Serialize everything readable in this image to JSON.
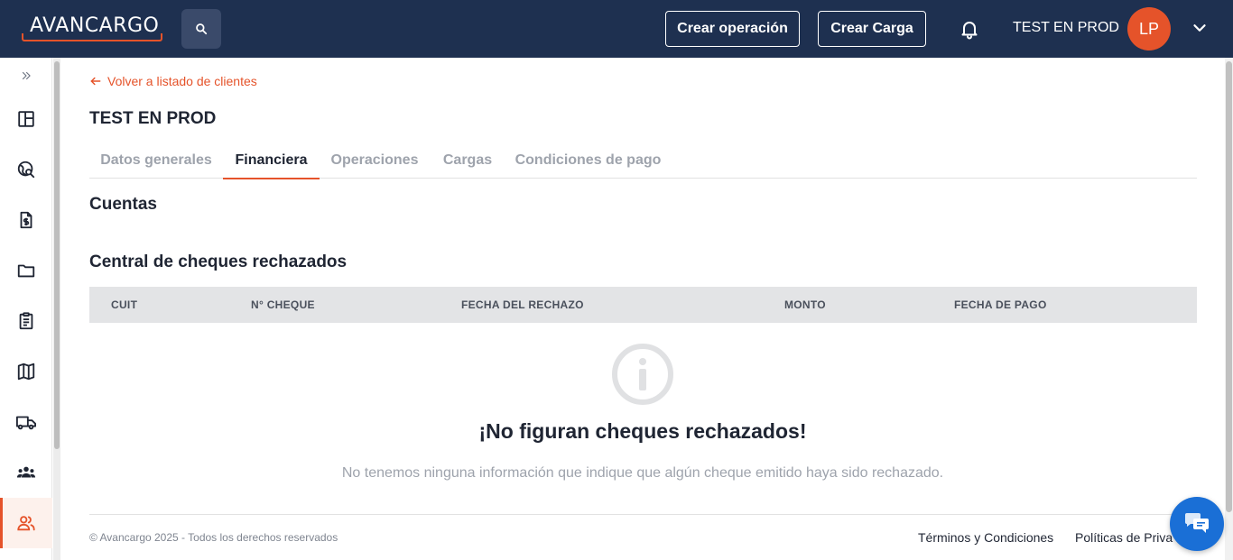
{
  "header": {
    "logo_text": "AVANCARGO",
    "create_operation_label": "Crear operación",
    "create_load_label": "Crear Carga",
    "username": "TEST EN PROD",
    "avatar_initials": "LP"
  },
  "sidebar": {
    "items": [
      {
        "icon": "expand-chevrons-icon"
      },
      {
        "icon": "dashboard-icon"
      },
      {
        "icon": "globe-search-icon"
      },
      {
        "icon": "invoice-icon"
      },
      {
        "icon": "folder-icon"
      },
      {
        "icon": "clipboard-icon"
      },
      {
        "icon": "map-icon"
      },
      {
        "icon": "truck-icon"
      },
      {
        "icon": "group-icon"
      },
      {
        "icon": "clients-icon",
        "active": true
      }
    ]
  },
  "main": {
    "back_link": "Volver a listado de clientes",
    "client_name": "TEST EN PROD",
    "tabs": [
      {
        "label": "Datos generales"
      },
      {
        "label": "Financiera",
        "active": true
      },
      {
        "label": "Operaciones"
      },
      {
        "label": "Cargas"
      },
      {
        "label": "Condiciones de pago"
      }
    ],
    "accounts_heading": "Cuentas",
    "checks_heading": "Central de cheques rechazados",
    "table_columns": [
      "CUIT",
      "N° CHEQUE",
      "FECHA DEL RECHAZO",
      "MONTO",
      "FECHA DE PAGO"
    ],
    "empty_title": "¡No figuran cheques rechazados!",
    "empty_description": "No tenemos ninguna información que indique que algún cheque emitido haya sido rechazado."
  },
  "footer": {
    "copyright": "© Avancargo 2025 - Todos los derechos reservados",
    "terms_link": "Términos y Condiciones",
    "privacy_link": "Políticas de Priva"
  },
  "colors": {
    "header_bg": "#1e3050",
    "accent": "#e5532a",
    "chat_bg": "#1a6fd6"
  }
}
